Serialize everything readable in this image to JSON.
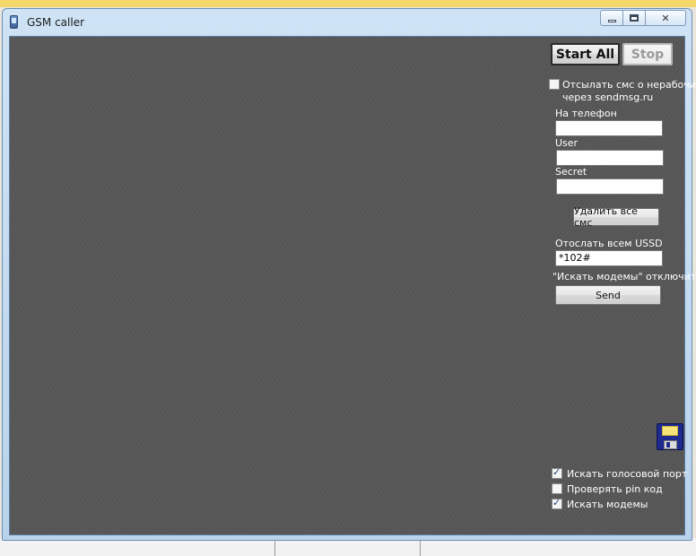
{
  "window": {
    "title": "GSM caller",
    "controls": {
      "minimize": "minimize",
      "maximize": "maximize",
      "close": "✕"
    }
  },
  "toolbar": {
    "start_all": "Start All",
    "stop": "Stop"
  },
  "sms_notify": {
    "checkbox_label_line1": "Отсылать смс о нерабочих",
    "checkbox_label_line2": "через sendmsg.ru",
    "checked": false,
    "phone_label": "На телефон",
    "phone_value": "",
    "user_label": "User",
    "user_value": "",
    "secret_label": "Secret",
    "secret_value": ""
  },
  "actions": {
    "delete_all_sms": "Удалить все смс"
  },
  "ussd": {
    "label": "Отослать всем USSD",
    "value": "*102#",
    "hint": "\"Искать модемы\" отключить",
    "send": "Send"
  },
  "options": [
    {
      "label": "Искать голосовой порт",
      "checked": true
    },
    {
      "label": "Проверять pin код",
      "checked": false
    },
    {
      "label": "Искать модемы",
      "checked": true
    }
  ],
  "icons": {
    "app": "phone-icon",
    "save": "floppy-disk-icon"
  }
}
